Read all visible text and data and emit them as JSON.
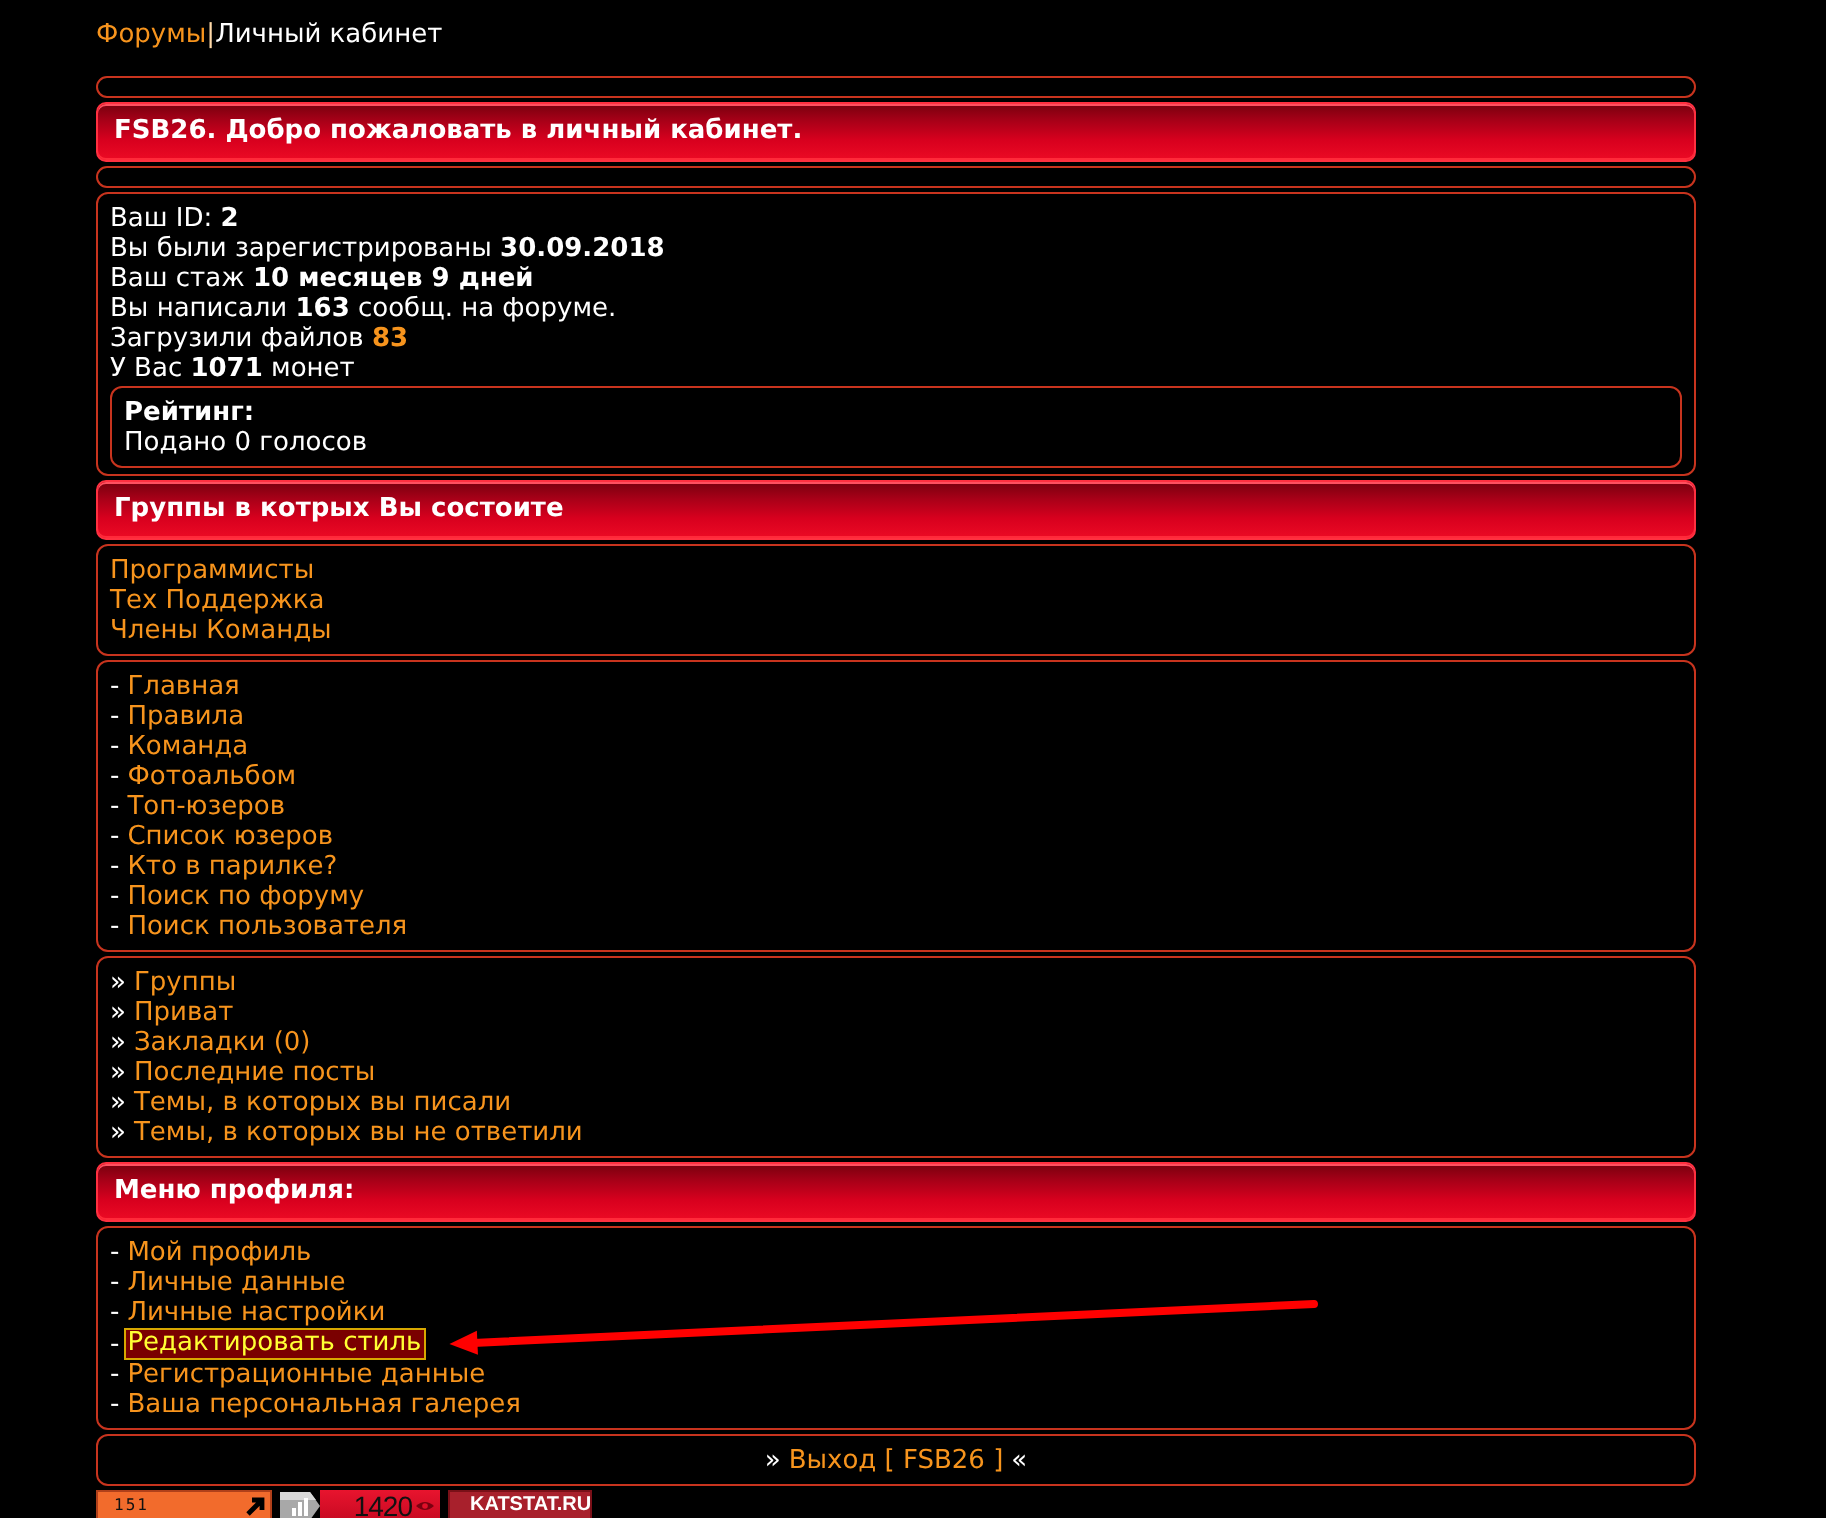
{
  "breadcrumb": {
    "link": "Форумы",
    "separator": "|",
    "current": "Личный кабинет"
  },
  "sections": [
    {
      "kind": "spacer"
    },
    {
      "kind": "header",
      "title": "FSB26. Добро пожаловать в личный кабинет."
    },
    {
      "kind": "spacer"
    },
    {
      "kind": "stats",
      "lines": [
        {
          "text": "Ваш ID: **2**"
        },
        {
          "text": "Вы были зарегистрированы **30.09.2018**"
        },
        {
          "text": "Ваш стаж **10 месяцев 9 дней**"
        },
        {
          "text": "Вы написали **163** сообщ. на форуме."
        },
        {
          "text": "Загрузили файлов",
          "link": "83"
        },
        {
          "text": "У Вас **1071** монет"
        }
      ],
      "rating": {
        "title": "Рейтинг:",
        "text": "Подано 0 голосов"
      }
    },
    {
      "kind": "header",
      "title": "Группы в котрых Вы состоите"
    },
    {
      "kind": "links",
      "items": [
        {
          "label": "Программисты"
        },
        {
          "label": "Тех Поддержка"
        },
        {
          "label": "Члены Команды"
        }
      ]
    },
    {
      "kind": "links",
      "items": [
        {
          "marker": "-",
          "label": "Главная"
        },
        {
          "marker": "-",
          "label": "Правила"
        },
        {
          "marker": "-",
          "label": "Команда"
        },
        {
          "marker": "-",
          "label": "Фотоальбом"
        },
        {
          "marker": "-",
          "label": "Топ-юзеров"
        },
        {
          "marker": "-",
          "label": "Список юзеров"
        },
        {
          "marker": "-",
          "label": "Кто в парилке?"
        },
        {
          "marker": "-",
          "label": "Поиск по форуму"
        },
        {
          "marker": "-",
          "label": "Поиск пользователя"
        }
      ]
    },
    {
      "kind": "links",
      "items": [
        {
          "marker": "»",
          "label": "Группы"
        },
        {
          "marker": "»",
          "label": "Приват"
        },
        {
          "marker": "»",
          "label": "Закладки (0)"
        },
        {
          "marker": "»",
          "label": "Последние посты"
        },
        {
          "marker": "»",
          "label": "Темы, в которых вы писали"
        },
        {
          "marker": "»",
          "label": "Темы, в которых вы не ответили"
        }
      ]
    },
    {
      "kind": "header",
      "title": "Меню профиля:"
    },
    {
      "kind": "links",
      "items": [
        {
          "marker": "-",
          "label": "Мой профиль",
          "highlighted": false
        },
        {
          "marker": "-",
          "label": "Личные данные",
          "highlighted": false
        },
        {
          "marker": "-",
          "label": "Личные настройки",
          "highlighted": false
        },
        {
          "marker": "-",
          "label": "Редактировать стиль",
          "highlighted": true
        },
        {
          "marker": "-",
          "label": "Регистрационные данные",
          "highlighted": false
        },
        {
          "marker": "-",
          "label": "Ваша персональная галерея",
          "highlighted": false
        }
      ]
    },
    {
      "kind": "footer",
      "before": "»",
      "link": "Выход [ FSB26 ]",
      "after": "«"
    }
  ],
  "counters": [
    {
      "kind": "hits",
      "text": "151"
    },
    {
      "kind": "views",
      "text": "1420"
    },
    {
      "kind": "brand",
      "text": "KATSTAT.RU"
    }
  ]
}
